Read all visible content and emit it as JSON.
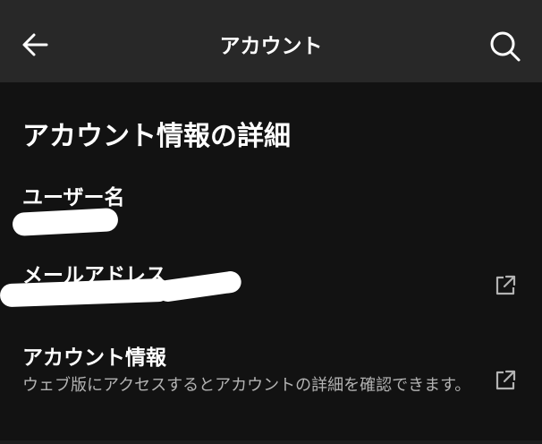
{
  "header": {
    "title": "アカウント",
    "back_icon": "arrow-left-icon",
    "search_icon": "search-icon"
  },
  "section": {
    "title": "アカウント情報の詳細"
  },
  "fields": {
    "username": {
      "label": "ユーザー名"
    },
    "email": {
      "label": "メールアドレス",
      "action_icon": "external-link-icon"
    },
    "account_info": {
      "label": "アカウント情報",
      "description": "ウェブ版にアクセスするとアカウントの詳細を確認できます。",
      "action_icon": "external-link-icon"
    }
  },
  "colors": {
    "background": "#121212",
    "appbar": "#282828",
    "text_primary": "#ffffff",
    "text_secondary": "#b3b3b3"
  }
}
